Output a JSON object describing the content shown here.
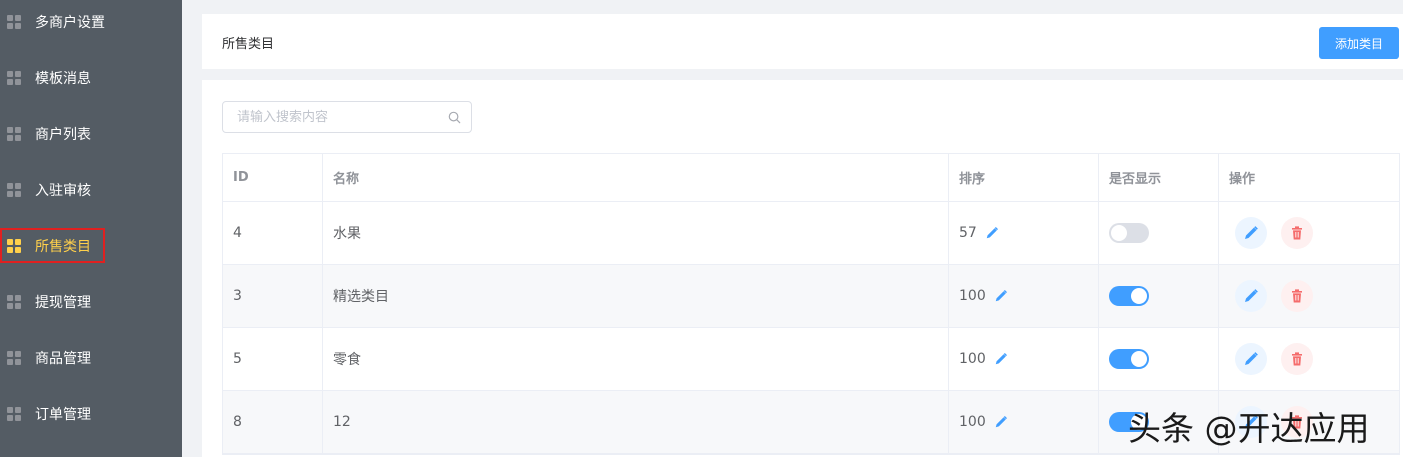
{
  "sidebar": {
    "items": [
      {
        "label": "多商户设置",
        "active": false
      },
      {
        "label": "模板消息",
        "active": false
      },
      {
        "label": "商户列表",
        "active": false
      },
      {
        "label": "入驻审核",
        "active": false
      },
      {
        "label": "所售类目",
        "active": true
      },
      {
        "label": "提现管理",
        "active": false
      },
      {
        "label": "商品管理",
        "active": false
      },
      {
        "label": "订单管理",
        "active": false
      }
    ]
  },
  "header": {
    "title": "所售类目",
    "add_button": "添加类目"
  },
  "search": {
    "placeholder": "请输入搜索内容",
    "icon": "search-icon"
  },
  "table": {
    "columns": [
      "ID",
      "名称",
      "排序",
      "是否显示",
      "操作"
    ],
    "rows": [
      {
        "id": "4",
        "name": "水果",
        "sort": "57",
        "show": false
      },
      {
        "id": "3",
        "name": "精选类目",
        "sort": "100",
        "show": true
      },
      {
        "id": "5",
        "name": "零食",
        "sort": "100",
        "show": true
      },
      {
        "id": "8",
        "name": "12",
        "sort": "100",
        "show": true
      }
    ]
  },
  "watermark": "头条 @开达应用",
  "colors": {
    "sidebar_bg": "#545c64",
    "active": "#ffd04b",
    "primary": "#409eff",
    "danger": "#f56c6c"
  }
}
